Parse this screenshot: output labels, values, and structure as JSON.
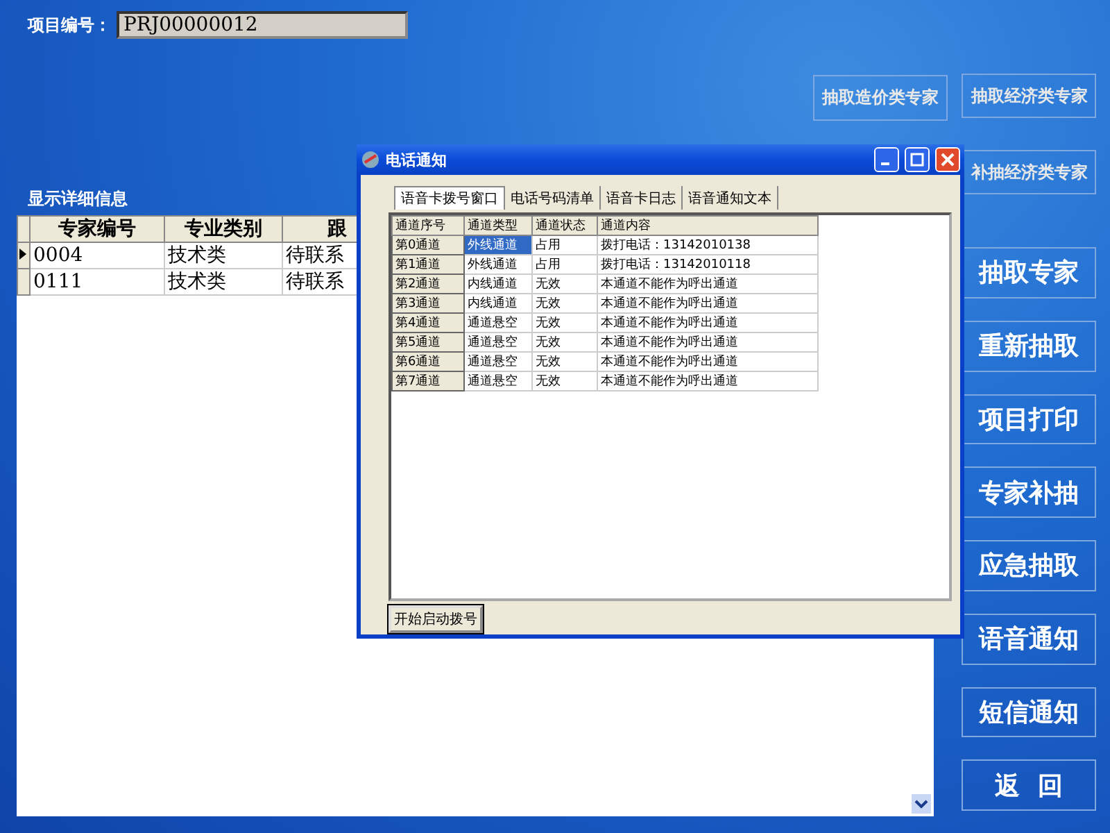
{
  "project": {
    "label": "项目编号：",
    "value": "PRJ00000012"
  },
  "top_buttons": [
    "抽取造价类专家",
    "抽取经济类专家",
    "补抽经济类专家"
  ],
  "detail_title": "显示详细信息",
  "table": {
    "columns": [
      "专家编号",
      "专业类别",
      "跟"
    ],
    "rows": [
      {
        "selected": true,
        "cells": [
          "0004",
          "技术类",
          "待联系"
        ]
      },
      {
        "selected": false,
        "cells": [
          "0111",
          "技术类",
          "待联系"
        ]
      }
    ]
  },
  "side_buttons": [
    "抽取专家",
    "重新抽取",
    "项目打印",
    "专家补抽",
    "应急抽取",
    "语音通知",
    "短信通知",
    "返  回"
  ],
  "dialog": {
    "title": "电话通知",
    "tabs": [
      {
        "label": "语音卡拨号窗口",
        "selected": true
      },
      {
        "label": "电话号码清单",
        "selected": false
      },
      {
        "label": "语音卡日志",
        "selected": false
      },
      {
        "label": "语音通知文本",
        "selected": false
      }
    ],
    "columns": [
      "通道序号",
      "通道类型",
      "通道状态",
      "通道内容"
    ],
    "rows": [
      {
        "selected": true,
        "cells": [
          "第0通道",
          "外线通道",
          "占用",
          "拨打电话：13142010138"
        ]
      },
      {
        "selected": false,
        "cells": [
          "第1通道",
          "外线通道",
          "占用",
          "拨打电话：13142010118"
        ]
      },
      {
        "selected": false,
        "cells": [
          "第2通道",
          "内线通道",
          "无效",
          "本通道不能作为呼出通道"
        ]
      },
      {
        "selected": false,
        "cells": [
          "第3通道",
          "内线通道",
          "无效",
          "本通道不能作为呼出通道"
        ]
      },
      {
        "selected": false,
        "cells": [
          "第4通道",
          "通道悬空",
          "无效",
          "本通道不能作为呼出通道"
        ]
      },
      {
        "selected": false,
        "cells": [
          "第5通道",
          "通道悬空",
          "无效",
          "本通道不能作为呼出通道"
        ]
      },
      {
        "selected": false,
        "cells": [
          "第6通道",
          "通道悬空",
          "无效",
          "本通道不能作为呼出通道"
        ]
      },
      {
        "selected": false,
        "cells": [
          "第7通道",
          "通道悬空",
          "无效",
          "本通道不能作为呼出通道"
        ]
      }
    ],
    "button": "开始启动拨号"
  }
}
